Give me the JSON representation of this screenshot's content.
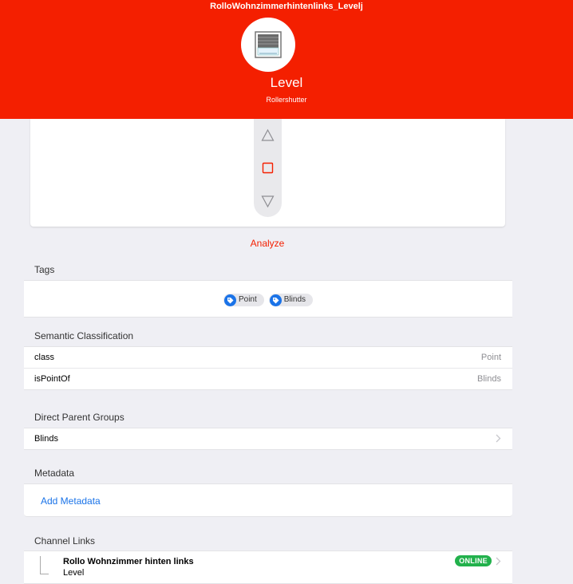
{
  "header": {
    "item_name": "RolloWohnzimmerhintenlinks_Levelj",
    "label": "Level",
    "type": "Rollershutter",
    "icon": "rollershutter-icon",
    "color": "#f41f00"
  },
  "controls": {
    "up": "triangle-up-icon",
    "stop": "square-stop-icon",
    "down": "triangle-down-icon"
  },
  "analyze_label": "Analyze",
  "tags": {
    "title": "Tags",
    "items": [
      "Point",
      "Blinds"
    ]
  },
  "semantic": {
    "title": "Semantic Classification",
    "rows": [
      {
        "key": "class",
        "value": "Point"
      },
      {
        "key": "isPointOf",
        "value": "Blinds"
      }
    ]
  },
  "parents": {
    "title": "Direct Parent Groups",
    "items": [
      "Blinds"
    ]
  },
  "metadata": {
    "title": "Metadata",
    "add_label": "Add Metadata"
  },
  "channel_links": {
    "title": "Channel Links",
    "items": [
      {
        "title": "Rollo Wohnzimmer hinten links",
        "subtitle": "Level",
        "status": "ONLINE",
        "status_color": "#22b14c"
      }
    ]
  }
}
